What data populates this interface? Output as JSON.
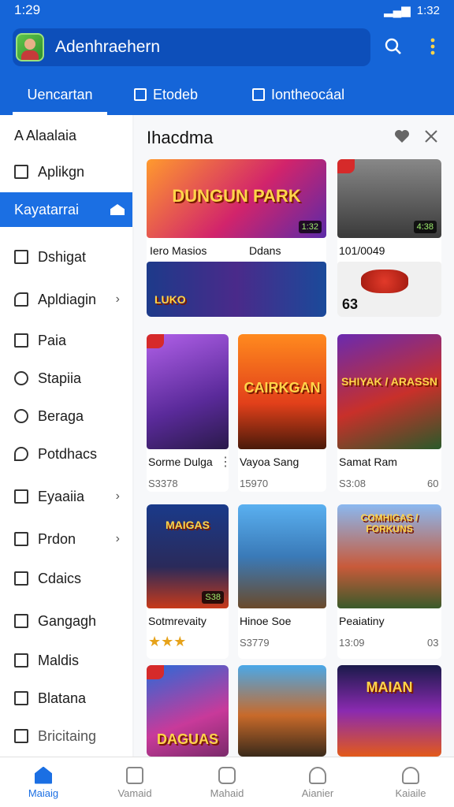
{
  "status": {
    "time": "1:29",
    "right_time": "1:32"
  },
  "app": {
    "title": "Adenhraehern"
  },
  "tabs": [
    {
      "label": "Uencartan"
    },
    {
      "label": "Etodeb"
    },
    {
      "label": "Iontheocáal"
    }
  ],
  "sidebar": {
    "items": [
      {
        "label": "A Alaalaia"
      },
      {
        "label": "Aplikgn"
      },
      {
        "label": "Kayatarrai"
      },
      {
        "label": "Dshigat"
      },
      {
        "label": "Apldiagin"
      },
      {
        "label": "Paia"
      },
      {
        "label": "Stapiia"
      },
      {
        "label": "Beraga"
      },
      {
        "label": "Potdhacs"
      },
      {
        "label": "Eyaaiia"
      },
      {
        "label": "Prdon"
      },
      {
        "label": "Cdaics"
      },
      {
        "label": "Gangagh"
      },
      {
        "label": "Maldis"
      },
      {
        "label": "Blatana"
      },
      {
        "label": "Bricitaing"
      }
    ]
  },
  "content": {
    "title": "Ihacdma",
    "featured": [
      {
        "thumb_text": "DUNGUN PARK",
        "title": "Iero Masios",
        "meta": "Ddans",
        "badge": "1:32"
      },
      {
        "title": "101/0049",
        "badge": "4:38"
      }
    ],
    "row_strip": [
      {
        "text": "LUKO"
      },
      {
        "text": "63"
      }
    ],
    "grid": [
      {
        "thumb_text": "",
        "title": "Sorme Dulga",
        "sub": "S3378"
      },
      {
        "thumb_text": "CAIRKGAN",
        "title": "Vayoa Sang",
        "sub": "15970"
      },
      {
        "thumb_text": "SHIYAK / ARASSN",
        "title": "Samat Ram",
        "sub": "S3:08"
      },
      {
        "thumb_text": "MAIGAS",
        "title": "Sotmrevaity",
        "sub": ""
      },
      {
        "thumb_text": "",
        "title": "Hinoe Soe",
        "sub": "S3779"
      },
      {
        "thumb_text": "COMHIGAS / FORKUNS",
        "title": "Peaiatiny",
        "sub": "13:09"
      },
      {
        "thumb_text": "DAGUAS",
        "title": "",
        "sub": ""
      },
      {
        "thumb_text": "",
        "title": "",
        "sub": ""
      },
      {
        "thumb_text": "MAIAN",
        "title": "",
        "sub": ""
      }
    ],
    "right_col_extra": [
      "60",
      "03"
    ],
    "grid_badges": [
      "S38"
    ]
  },
  "bottom_nav": [
    {
      "label": "Maiaig"
    },
    {
      "label": "Vamaid"
    },
    {
      "label": "Mahaid"
    },
    {
      "label": "Aianier"
    },
    {
      "label": "Kaiaile"
    }
  ]
}
